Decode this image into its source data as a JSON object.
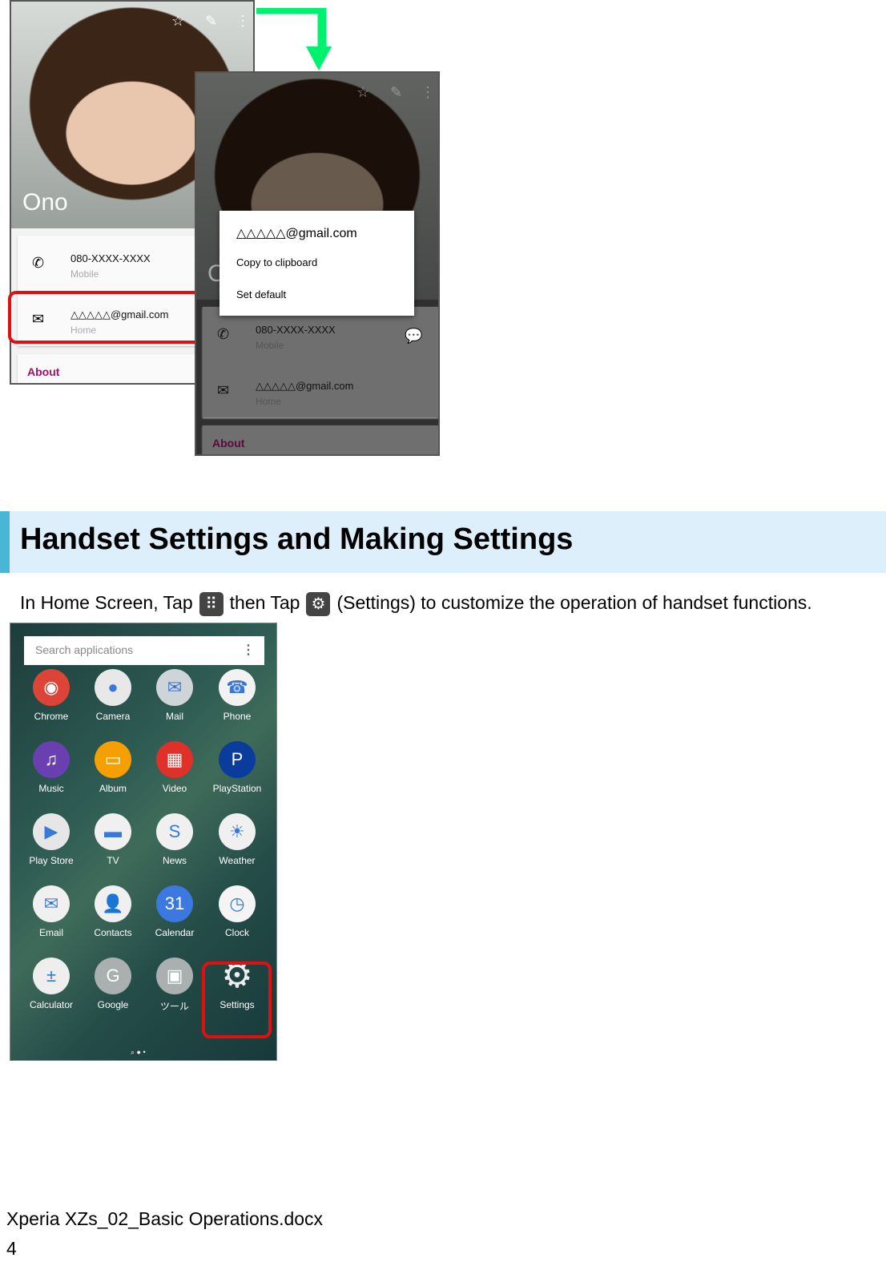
{
  "contact_before": {
    "name": "Ono",
    "phone": "080-XXXX-XXXX",
    "phone_type": "Mobile",
    "email": "△△△△△@gmail.com",
    "email_type": "Home",
    "about": "About"
  },
  "contact_after": {
    "name_partial": "O",
    "phone": "080-XXXX-XXXX",
    "phone_type": "Mobile",
    "email": "△△△△△@gmail.com",
    "email_type": "Home",
    "about": "About",
    "popup": {
      "title": "△△△△△@gmail.com",
      "items": [
        "Copy to clipboard",
        "Set default"
      ]
    }
  },
  "colors": {
    "highlight": "#e01010",
    "arrow": "#00f070",
    "accent_bar": "#49b6d6",
    "band": "#ddeffa",
    "about": "#a0106a"
  },
  "section": {
    "title": "Handset Settings and Making Settings",
    "text_1": "In Home Screen, Tap",
    "text_2": "then Tap",
    "text_3": "(Settings) to customize the operation of handset functions."
  },
  "drawer": {
    "search_placeholder": "Search applications",
    "apps": [
      {
        "label": "Chrome",
        "color": "#db4437",
        "glyph": "◉"
      },
      {
        "label": "Camera",
        "color": "#e8e8e8",
        "glyph": "●"
      },
      {
        "label": "Mail",
        "color": "#cfd4d8",
        "glyph": "✉"
      },
      {
        "label": "Phone",
        "color": "#f2f2f2",
        "glyph": "☎"
      },
      {
        "label": "Music",
        "color": "#6a3fb0",
        "glyph": "♫"
      },
      {
        "label": "Album",
        "color": "#f6a000",
        "glyph": "▭"
      },
      {
        "label": "Video",
        "color": "#e0302a",
        "glyph": "▦"
      },
      {
        "label": "PlayStation",
        "color": "#0a3c9c",
        "glyph": "P"
      },
      {
        "label": "Play Store",
        "color": "#e6e6e6",
        "glyph": "▶"
      },
      {
        "label": "TV",
        "color": "#f0f0f0",
        "glyph": "▬"
      },
      {
        "label": "News",
        "color": "#f0f0f0",
        "glyph": "S"
      },
      {
        "label": "Weather",
        "color": "#f0f0f0",
        "glyph": "☀"
      },
      {
        "label": "Email",
        "color": "#f0f0f0",
        "glyph": "✉"
      },
      {
        "label": "Contacts",
        "color": "#f0f0f0",
        "glyph": "👤"
      },
      {
        "label": "Calendar",
        "color": "#3b78e0",
        "glyph": "31"
      },
      {
        "label": "Clock",
        "color": "#f4f4f4",
        "glyph": "◷"
      },
      {
        "label": "Calculator",
        "color": "#eeeeee",
        "glyph": "±"
      },
      {
        "label": "Google",
        "color": "#aab0b0",
        "glyph": "G"
      },
      {
        "label": "ツール",
        "color": "#aab0b0",
        "glyph": "▣"
      },
      {
        "label": "Settings",
        "color": "transparent",
        "glyph": "⚙"
      }
    ]
  },
  "footer": {
    "filename": "Xperia XZs_02_Basic Operations.docx",
    "page": "4"
  }
}
